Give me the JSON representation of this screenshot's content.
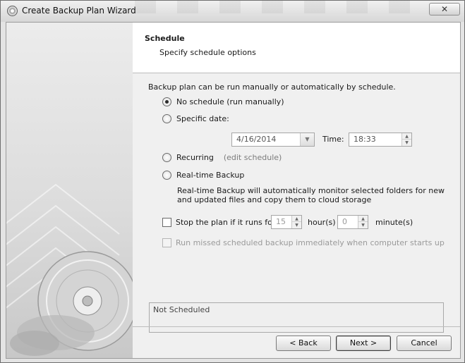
{
  "window": {
    "title": "Create Backup Plan Wizard",
    "close_glyph": "✕"
  },
  "header": {
    "title": "Schedule",
    "subtitle": "Specify schedule options"
  },
  "intro": "Backup plan can be run manually or automatically by schedule.",
  "options": {
    "no_schedule": {
      "label": "No schedule (run manually)",
      "selected": true
    },
    "specific_date": {
      "label": "Specific date:",
      "date_value": "4/16/2014",
      "time_label": "Time:",
      "time_value": "18:33"
    },
    "recurring": {
      "label": "Recurring",
      "edit_link": "(edit schedule)"
    },
    "realtime": {
      "label": "Real-time Backup",
      "description_line1": "Real-time Backup will automatically monitor selected folders for new",
      "description_line2": "and updated files and copy them to cloud storage"
    }
  },
  "stop_plan": {
    "label": "Stop the plan if it runs for:",
    "hours_value": "15",
    "hours_label": "hour(s)",
    "minutes_value": "0",
    "minutes_label": "minute(s)",
    "checked": false
  },
  "run_missed": {
    "label": "Run missed scheduled backup immediately when computer starts up",
    "enabled": false
  },
  "status_text": "Not Scheduled",
  "buttons": {
    "back": "< Back",
    "next": "Next >",
    "cancel": "Cancel"
  },
  "icons": {
    "app": "backup-disc-icon",
    "side_art": "cd-disc-icon"
  },
  "colors": {
    "header_bg": "#ffffff",
    "dialog_bg": "#f0f0f0"
  }
}
